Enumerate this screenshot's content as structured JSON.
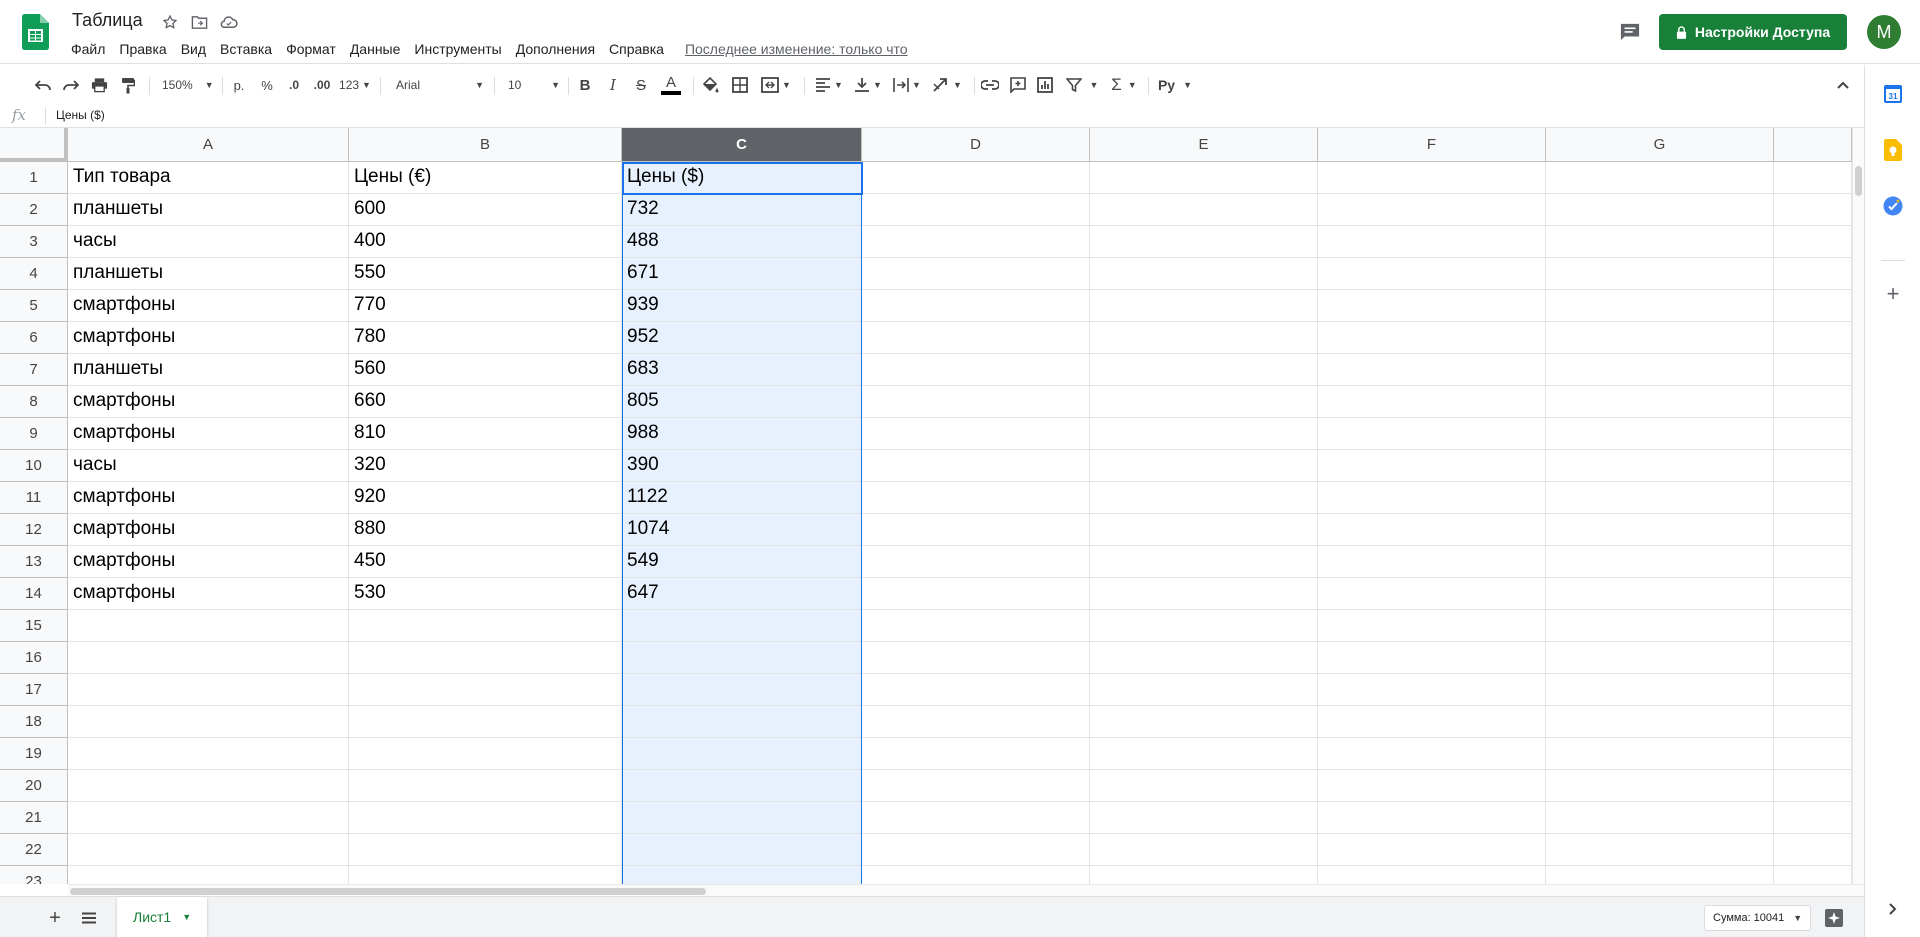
{
  "header": {
    "title": "Таблица",
    "menu": [
      "Файл",
      "Правка",
      "Вид",
      "Вставка",
      "Формат",
      "Данные",
      "Инструменты",
      "Дополнения",
      "Справка"
    ],
    "last_edit": "Последнее изменение: только что",
    "share_label": "Настройки Доступа",
    "avatar_letter": "M"
  },
  "toolbar": {
    "zoom": "150%",
    "currency": "р.",
    "percent": "%",
    "decrease_decimal": ".0",
    "increase_decimal": ".00",
    "number_format": "123",
    "font": "Arial",
    "font_size": "10"
  },
  "formula_bar": {
    "fx": "fx",
    "content": "Цены ($)"
  },
  "columns": [
    "A",
    "B",
    "C",
    "D",
    "E",
    "F",
    "G"
  ],
  "selected_column": "C",
  "active_cell": "C1",
  "row_numbers": [
    "1",
    "2",
    "3",
    "4",
    "5",
    "6",
    "7",
    "8",
    "9",
    "10",
    "11",
    "12",
    "13",
    "14",
    "15",
    "16",
    "17",
    "18",
    "19",
    "20",
    "21",
    "22",
    "23"
  ],
  "rows": [
    [
      "Тип товара",
      "Цены (€)",
      "Цены ($)"
    ],
    [
      "планшеты",
      "600",
      "732"
    ],
    [
      "часы",
      "400",
      "488"
    ],
    [
      "планшеты",
      "550",
      "671"
    ],
    [
      "смартфоны",
      "770",
      "939"
    ],
    [
      "смартфоны",
      "780",
      "952"
    ],
    [
      "планшеты",
      "560",
      "683"
    ],
    [
      "смартфоны",
      "660",
      "805"
    ],
    [
      "смартфоны",
      "810",
      "988"
    ],
    [
      "часы",
      "320",
      "390"
    ],
    [
      "смартфоны",
      "920",
      "1122"
    ],
    [
      "смартфоны",
      "880",
      "1074"
    ],
    [
      "смартфоны",
      "450",
      "549"
    ],
    [
      "смартфоны",
      "530",
      "647"
    ]
  ],
  "bottom_bar": {
    "sheet_name": "Лист1",
    "sum_label": "Сумма: 10041"
  },
  "side_panel": {
    "calendar_day": "31"
  },
  "colors": {
    "brand_green": "#188038",
    "selection_blue": "#1a73e8",
    "selection_fill": "#e7f0fd",
    "selected_header": "#5f6368"
  }
}
